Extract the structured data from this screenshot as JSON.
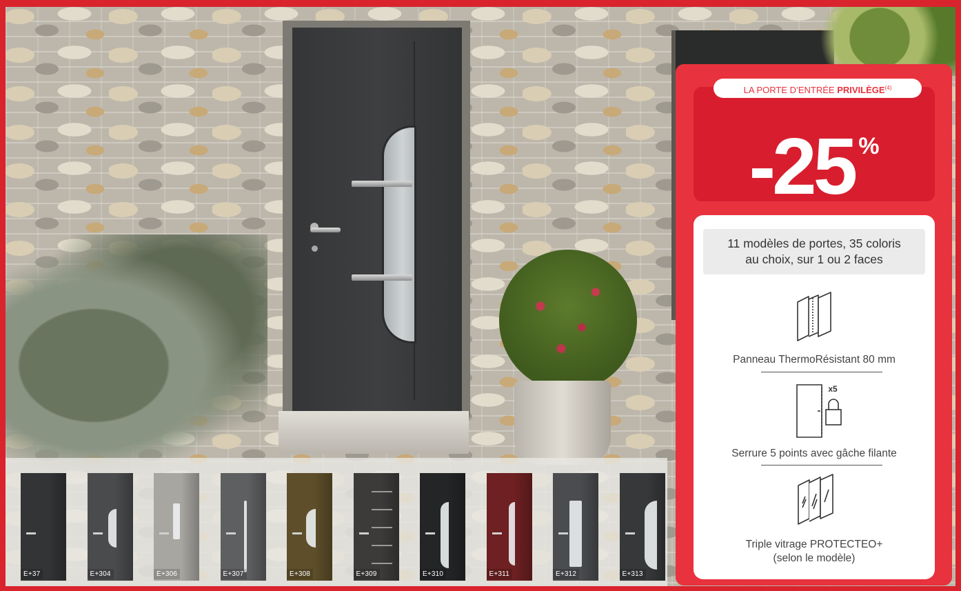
{
  "promo": {
    "pill_prefix": "LA PORTE D’ENTRÉE",
    "pill_bold": "PRIVILÈGE",
    "pill_note": "(4)",
    "discount_value": "-25",
    "discount_unit": "%"
  },
  "features": {
    "headline_line1": "11 modèles de portes, 35 coloris",
    "headline_line2": "au choix, sur 1 ou 2 faces",
    "items": [
      {
        "icon": "panel-layers-icon",
        "text": "Panneau ThermoRésistant 80 mm"
      },
      {
        "icon": "padlock-icon",
        "badge": "x5",
        "text": "Serrure 5 points avec gâche filante"
      },
      {
        "icon": "triple-glazing-icon",
        "text_line1": "Triple vitrage PROTECTEO+",
        "text_line2": "(selon le modèle)"
      }
    ]
  },
  "models": [
    {
      "code": "E+37",
      "color": "#333436"
    },
    {
      "code": "E+304",
      "color": "#4a4b4d"
    },
    {
      "code": "E+306",
      "color": "#a8a6a1"
    },
    {
      "code": "E+307",
      "color": "#5e5f61"
    },
    {
      "code": "E+308",
      "color": "#5e4f2a"
    },
    {
      "code": "E+309",
      "color": "#3c3b3a"
    },
    {
      "code": "E+310",
      "color": "#242526"
    },
    {
      "code": "E+311",
      "color": "#6e2022"
    },
    {
      "code": "E+312",
      "color": "#4a4c4f"
    },
    {
      "code": "E+313",
      "color": "#36383a"
    }
  ]
}
